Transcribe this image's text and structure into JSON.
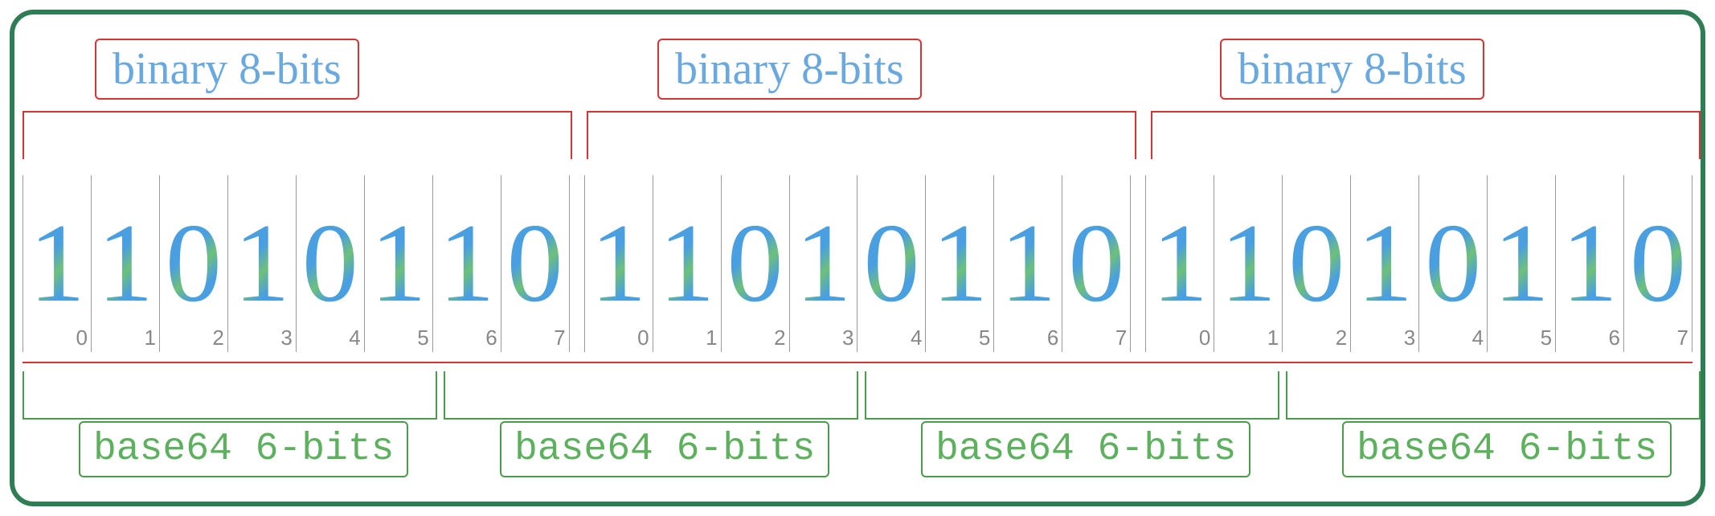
{
  "byte_labels": [
    "binary 8-bits",
    "binary 8-bits",
    "binary 8-bits"
  ],
  "b64_labels": [
    "base64 6-bits",
    "base64 6-bits",
    "base64 6-bits",
    "base64 6-bits"
  ],
  "bytes": [
    {
      "bits": [
        "1",
        "1",
        "0",
        "1",
        "0",
        "1",
        "1",
        "0"
      ],
      "indices": [
        "0",
        "1",
        "2",
        "3",
        "4",
        "5",
        "6",
        "7"
      ]
    },
    {
      "bits": [
        "1",
        "1",
        "0",
        "1",
        "0",
        "1",
        "1",
        "0"
      ],
      "indices": [
        "0",
        "1",
        "2",
        "3",
        "4",
        "5",
        "6",
        "7"
      ]
    },
    {
      "bits": [
        "1",
        "1",
        "0",
        "1",
        "0",
        "1",
        "1",
        "0"
      ],
      "indices": [
        "0",
        "1",
        "2",
        "3",
        "4",
        "5",
        "6",
        "7"
      ]
    }
  ],
  "colors": {
    "border": "#2e7d55",
    "red": "#d93434",
    "green": "#4a9d4a",
    "bit_blue": "#4a9fe0",
    "label_blue": "#6aa8e0"
  }
}
